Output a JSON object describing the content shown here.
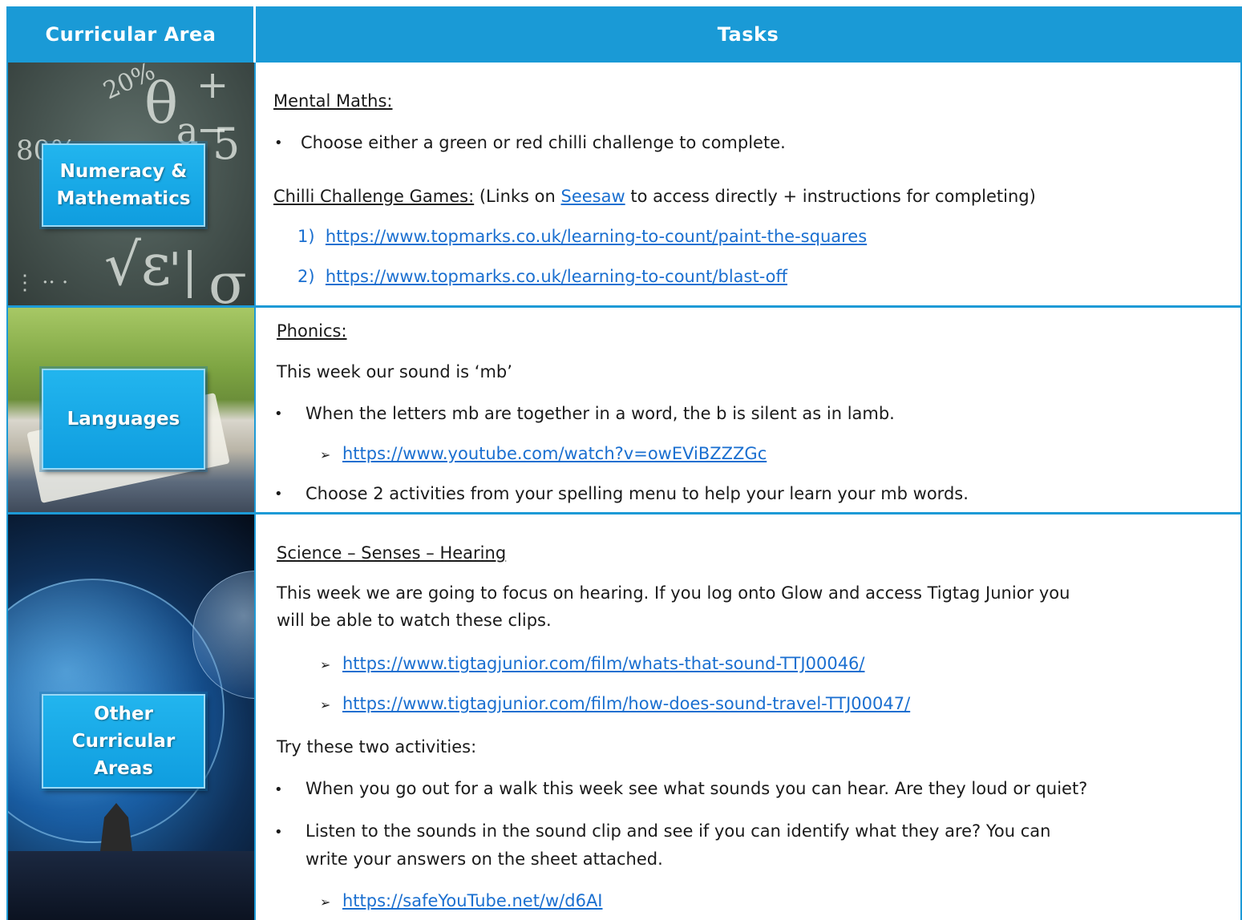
{
  "header": {
    "area_label": "Curricular Area",
    "tasks_label": "Tasks"
  },
  "rows": {
    "maths": {
      "area": "Numeracy & Mathematics",
      "heading": "Mental Maths:",
      "bullet1": "Choose either a green or red chilli challenge to complete.",
      "games_heading": "Chilli Challenge Games:",
      "games_pre": " (Links on ",
      "games_link": "Seesaw",
      "games_post": " to access directly + instructions for completing)",
      "links": [
        {
          "num": "1)",
          "url": "https://www.topmarks.co.uk/learning-to-count/paint-the-squares"
        },
        {
          "num": "2)",
          "url": "https://www.topmarks.co.uk/learning-to-count/blast-off"
        }
      ]
    },
    "languages": {
      "area": "Languages",
      "heading": "Phonics:",
      "intro": "This week our sound is ‘mb’",
      "bullet1": "When the letters mb are together in a word, the b is silent as in lamb.",
      "link1": "https://www.youtube.com/watch?v=owEViBZZZGc",
      "bullet2": "Choose 2 activities from your spelling menu to help your learn your mb words."
    },
    "other": {
      "area": "Other Curricular Areas",
      "heading": "Science – Senses – Hearing",
      "para_line1": "This week we are going to focus on hearing. If you log onto Glow and access Tigtag Junior you",
      "para_line2": "will be able to watch these clips.",
      "link1": "https://www.tigtagjunior.com/film/whats-that-sound-TTJ00046/",
      "link2": "https://www.tigtagjunior.com/film/how-does-sound-travel-TTJ00047/",
      "try_label": "Try these two activities:",
      "bullet1": "When you go out for a walk this week see what sounds you can hear. Are they loud or quiet?",
      "bullet2_line1": "Listen to the sounds in the sound clip and see if you can identify what they are? You can",
      "bullet2_line2": "write your answers on the sheet attached.",
      "link3": "https://safeYouTube.net/w/d6AI"
    }
  },
  "icons": {
    "bullet": "•",
    "arrow": "➢"
  },
  "colors": {
    "header_bg": "#1a9ad6",
    "link": "#1a6fd0",
    "area_box": "#0f9ddf"
  }
}
